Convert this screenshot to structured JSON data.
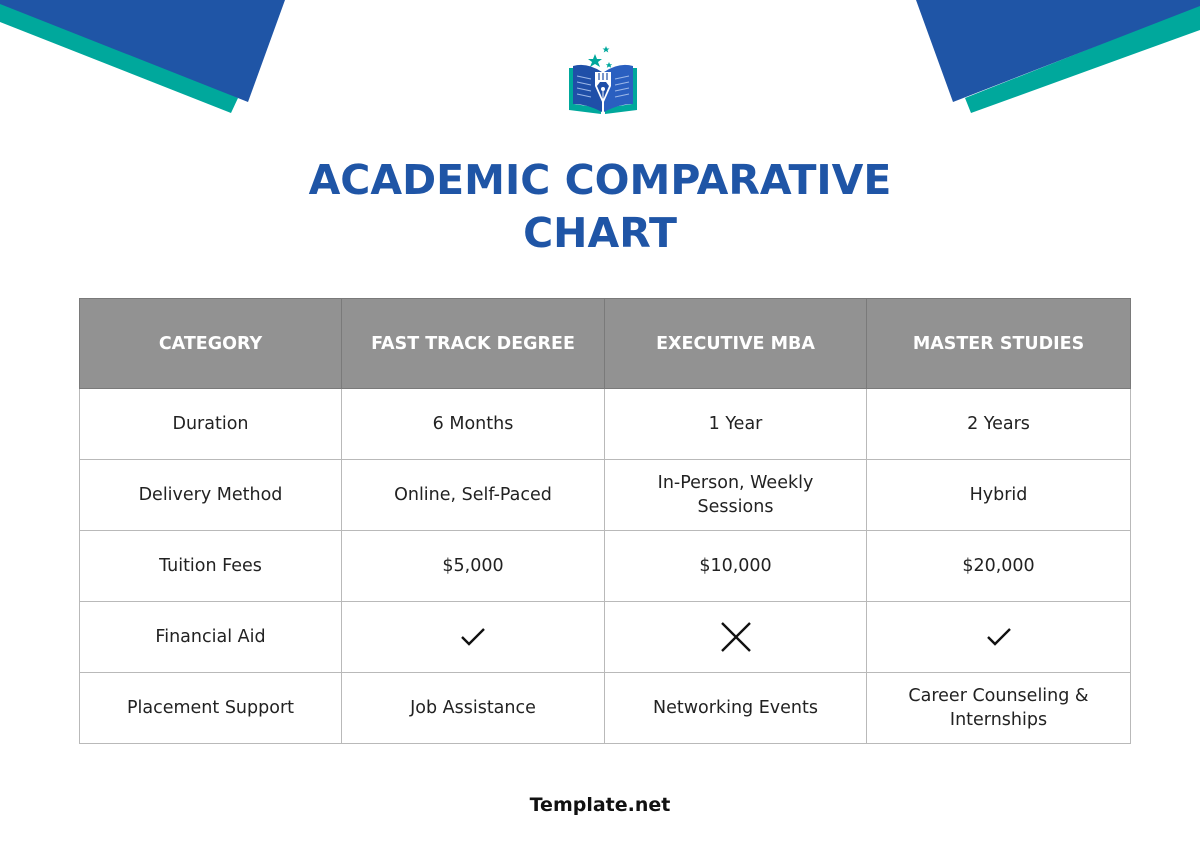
{
  "colors": {
    "brand_blue": "#1f55a6",
    "accent_teal": "#00a89c",
    "header_gray": "#929292"
  },
  "logo": {
    "icon": "book-pen-stars-icon"
  },
  "title": {
    "line1": "ACADEMIC COMPARATIVE",
    "line2": "CHART"
  },
  "table": {
    "headers": [
      "CATEGORY",
      "FAST TRACK DEGREE",
      "EXECUTIVE MBA",
      "MASTER STUDIES"
    ],
    "rows": [
      {
        "category": "Duration",
        "values": [
          "6 Months",
          "1 Year",
          "2 Years"
        ]
      },
      {
        "category": "Delivery Method",
        "values": [
          "Online, Self-Paced",
          "In-Person, Weekly Sessions",
          "Hybrid"
        ]
      },
      {
        "category": "Tuition Fees",
        "values": [
          "$5,000",
          "$10,000",
          "$20,000"
        ]
      },
      {
        "category": "Financial Aid",
        "values": [
          "check-icon",
          "cross-icon",
          "check-icon"
        ],
        "available": [
          true,
          false,
          true
        ]
      },
      {
        "category": "Placement Support",
        "values": [
          "Job Assistance",
          "Networking Events",
          "Career Counseling & Internships"
        ]
      }
    ]
  },
  "footer": {
    "brand": "Template.net"
  }
}
